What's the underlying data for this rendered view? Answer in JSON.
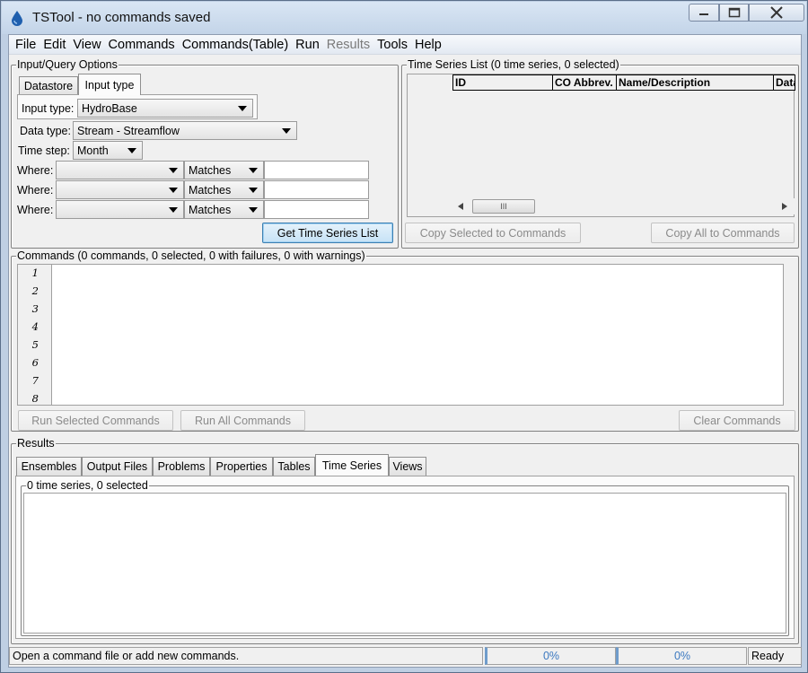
{
  "window": {
    "title": "TSTool - no commands saved"
  },
  "menu": [
    "File",
    "Edit",
    "View",
    "Commands",
    "Commands(Table)",
    "Run",
    "Results",
    "Tools",
    "Help"
  ],
  "menu_disabled": [
    "Results"
  ],
  "input_query": {
    "group_title": "Input/Query Options",
    "tabs": [
      "Datastore",
      "Input type"
    ],
    "input_type_label": "Input type:",
    "input_type_value": "HydroBase",
    "data_type_label": "Data type:",
    "data_type_value": "Stream - Streamflow",
    "time_step_label": "Time step:",
    "time_step_value": "Month",
    "where_label": "Where:",
    "where_rows": [
      {
        "field": "",
        "operator": "Matches",
        "value": ""
      },
      {
        "field": "",
        "operator": "Matches",
        "value": ""
      },
      {
        "field": "",
        "operator": "Matches",
        "value": ""
      }
    ],
    "get_list_button": "Get Time Series List"
  },
  "ts_list": {
    "group_title": "Time Series List (0 time series, 0 selected)",
    "columns": [
      "ID",
      "CO Abbrev.",
      "Name/Description",
      "Data"
    ],
    "copy_selected_button": "Copy Selected to Commands",
    "copy_all_button": "Copy All to Commands",
    "scroll_grip": "III"
  },
  "commands": {
    "group_title": "Commands (0 commands, 0 selected, 0 with failures, 0 with warnings)",
    "line_numbers": [
      "1",
      "2",
      "3",
      "4",
      "5",
      "6",
      "7",
      "8"
    ],
    "run_selected_button": "Run Selected Commands",
    "run_all_button": "Run All Commands",
    "clear_button": "Clear Commands"
  },
  "results": {
    "group_title": "Results",
    "tabs": [
      "Ensembles",
      "Output Files",
      "Problems",
      "Properties",
      "Tables",
      "Time Series",
      "Views"
    ],
    "active_tab": "Time Series",
    "ts_panel_title": "0 time series, 0 selected"
  },
  "status": {
    "message": "Open a command file or add new commands.",
    "progress1": "0%",
    "progress2": "0%",
    "state": "Ready"
  },
  "colors": {
    "accent": "#3c79c0",
    "window_frame": "#bfcfe3",
    "panel": "#f0f0f0"
  }
}
